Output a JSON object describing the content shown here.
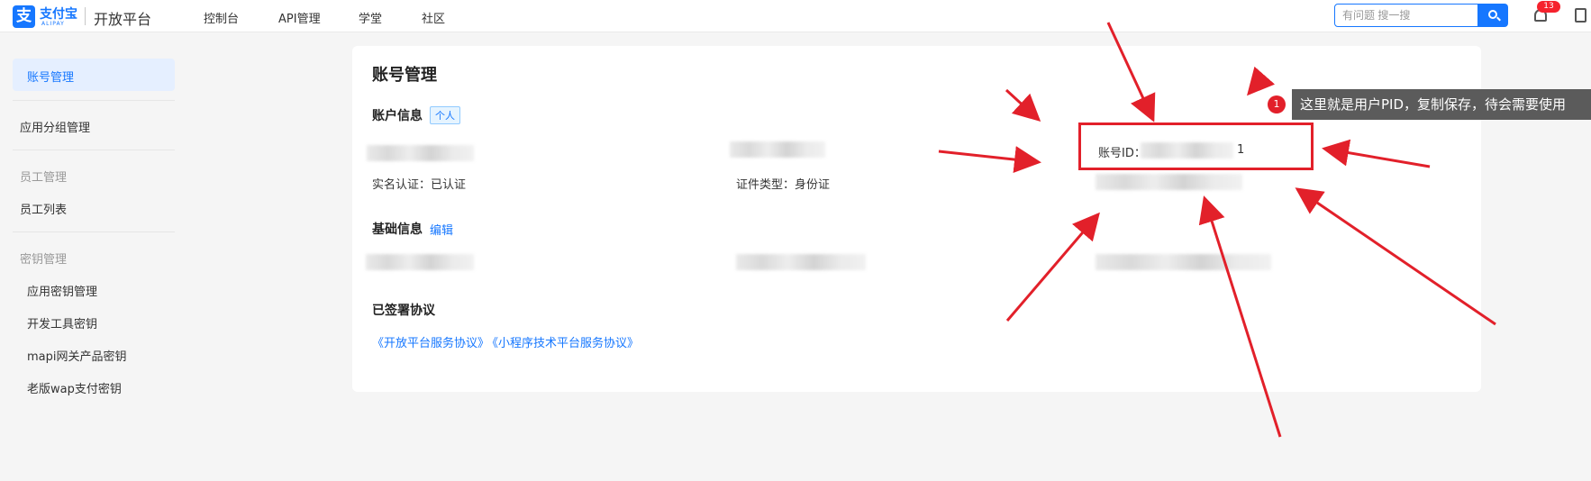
{
  "header": {
    "logo_cn": "支付宝",
    "logo_en": "ALIPAY",
    "platform": "开放平台",
    "nav": [
      "控制台",
      "API管理",
      "学堂",
      "社区"
    ],
    "search_placeholder": "有问题 搜一搜",
    "notifications": "13"
  },
  "sidebar": {
    "items": [
      "账号管理",
      "应用分组管理"
    ],
    "staff_group": "员工管理",
    "staff_items": [
      "员工列表"
    ],
    "key_group": "密钥管理",
    "key_items": [
      "应用密钥管理",
      "开发工具密钥",
      "mapi网关产品密钥",
      "老版wap支付密钥"
    ]
  },
  "main": {
    "title": "账号管理",
    "account_info": "账户信息",
    "account_tag": "个人",
    "real_name": "实名认证：已认证",
    "cert_type": "证件类型：身份证",
    "account_id_label": "账号ID：",
    "account_id_suffix": "1",
    "basic_info": "基础信息",
    "edit": "编辑",
    "agreements_title": "已签署协议",
    "agreements": [
      "《开放平台服务协议》",
      "《小程序技术平台服务协议》"
    ]
  },
  "annotation": {
    "number": "1",
    "text": "这里就是用户PID，复制保存，待会需要使用",
    "color": "#e2202a"
  }
}
